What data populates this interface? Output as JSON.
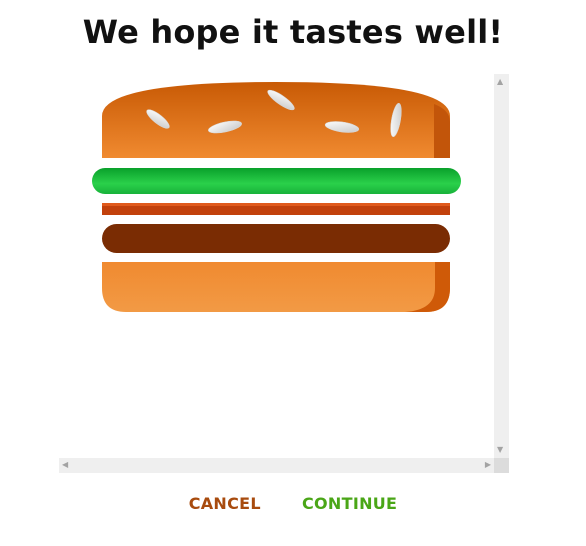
{
  "dialog": {
    "title": "We hope it tastes well!",
    "cancel_label": "CANCEL",
    "continue_label": "CONTINUE"
  },
  "scrollbars": {
    "up_arrow": "▲",
    "down_arrow": "▼",
    "left_arrow": "◀",
    "right_arrow": "▶"
  },
  "colors": {
    "cancel": "#a84b0e",
    "continue": "#4aa617",
    "bun_top": "#d66f12",
    "bun_bottom": "#f08a30",
    "lettuce": "#1cb93a",
    "tomato": "#c2410c",
    "patty": "#7a2c03"
  },
  "icons": {
    "illustration": "hamburger-illustration"
  }
}
